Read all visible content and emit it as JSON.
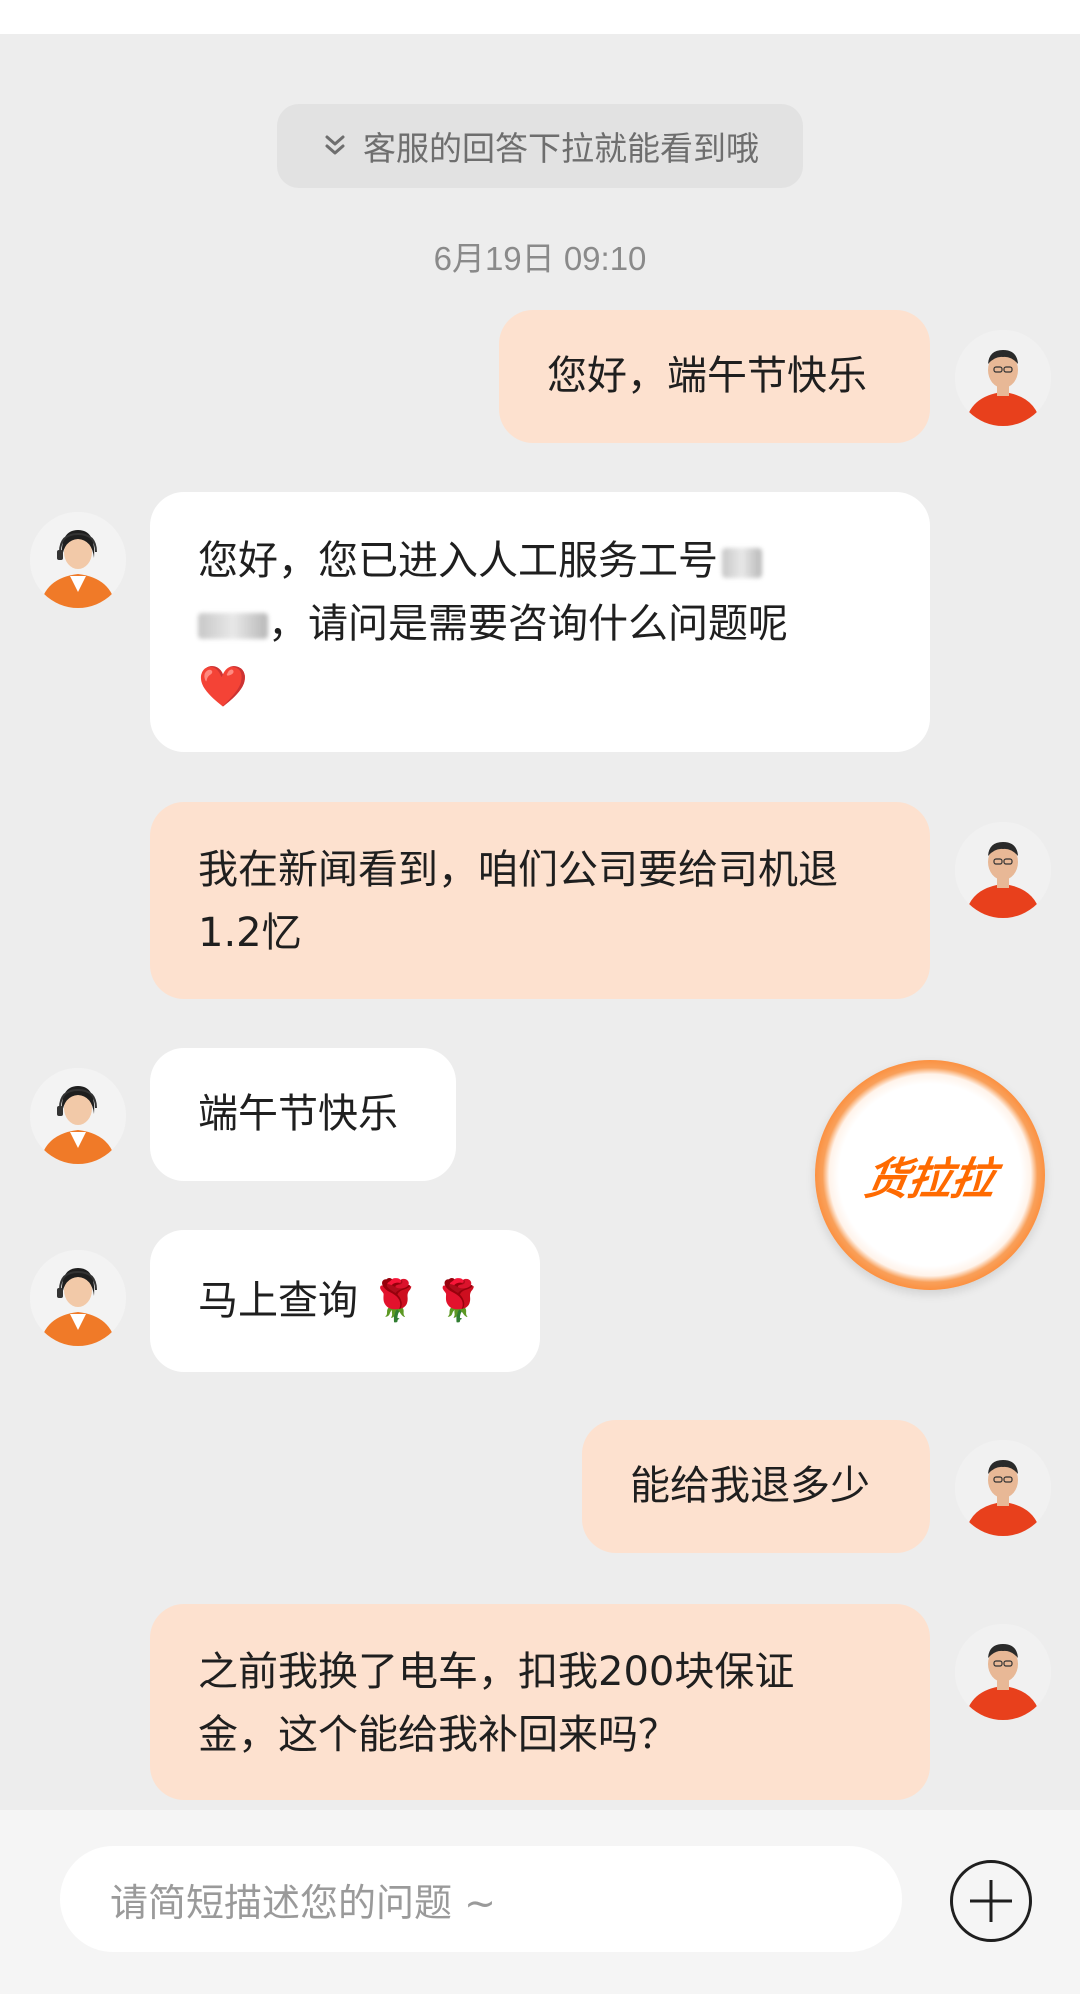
{
  "banner": {
    "text": "客服的回答下拉就能看到哦",
    "icon": "double-chevron-down-icon"
  },
  "timestamp": "6月19日 09:10",
  "messages": [
    {
      "from": "user",
      "text": "您好，端午节快乐"
    },
    {
      "from": "agent",
      "line1": "您好，您已进入人工服务工号",
      "line2": "，请问是需要咨询什么问题呢",
      "emoji": "❤️"
    },
    {
      "from": "user",
      "line1": "我在新闻看到，咱们公司要给司机退",
      "line2": "1.2忆"
    },
    {
      "from": "agent",
      "text": "端午节快乐"
    },
    {
      "from": "agent",
      "text": "马上查询",
      "emoji": "🌹 🌹"
    },
    {
      "from": "user",
      "text": "能给我退多少"
    },
    {
      "from": "user",
      "line1": "之前我换了电车，扣我200块保证",
      "line2": "金，这个能给我补回来吗？"
    }
  ],
  "floating_logo": {
    "text": "货拉拉"
  },
  "input": {
    "placeholder": "请简短描述您的问题 ~"
  },
  "colors": {
    "user_bubble": "#fde1cf",
    "agent_bubble": "#ffffff",
    "brand": "#ff6a00",
    "background": "#ededed"
  }
}
